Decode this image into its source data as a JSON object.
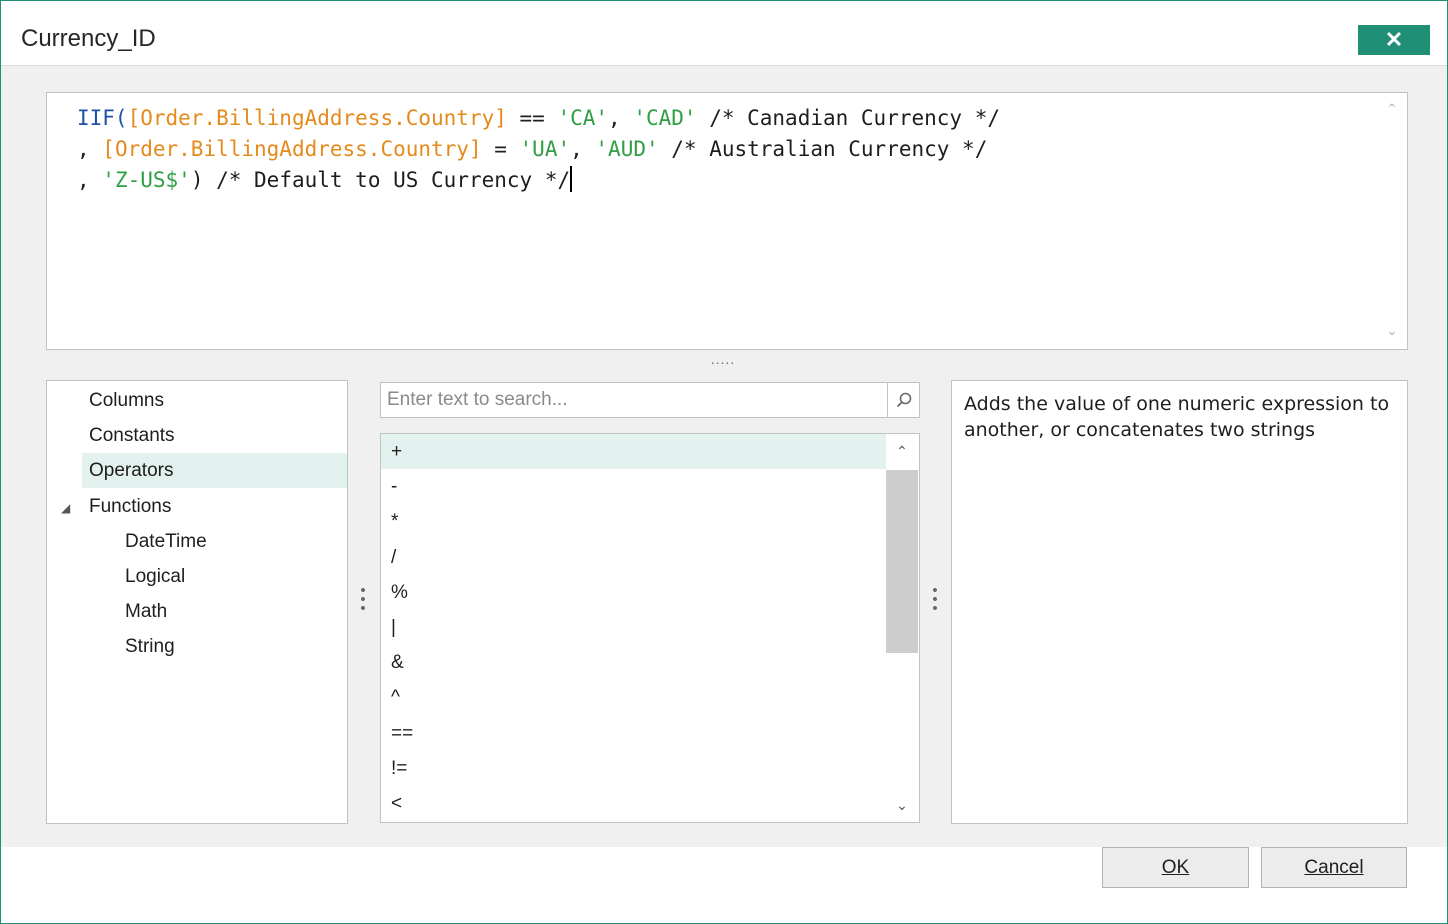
{
  "window": {
    "title": "Currency_ID",
    "close_label": "✕"
  },
  "editor": {
    "lines": [
      [
        {
          "t": "IIF(",
          "c": "kw"
        },
        {
          "t": "[Order.BillingAddress.Country]",
          "c": "fld"
        },
        {
          "t": " == ",
          "c": ""
        },
        {
          "t": "'CA'",
          "c": "str"
        },
        {
          "t": ", ",
          "c": ""
        },
        {
          "t": "'CAD'",
          "c": "str"
        },
        {
          "t": " /* Canadian Currency */",
          "c": ""
        }
      ],
      [
        {
          "t": ", ",
          "c": ""
        },
        {
          "t": "[Order.BillingAddress.Country]",
          "c": "fld"
        },
        {
          "t": " = ",
          "c": ""
        },
        {
          "t": "'UA'",
          "c": "str"
        },
        {
          "t": ", ",
          "c": ""
        },
        {
          "t": "'AUD'",
          "c": "str"
        },
        {
          "t": " /* Australian Currency */",
          "c": ""
        }
      ],
      [
        {
          "t": ", ",
          "c": ""
        },
        {
          "t": "'Z-US$'",
          "c": "str"
        },
        {
          "t": ") /* Default to US Currency */",
          "c": ""
        }
      ]
    ]
  },
  "splitter_label": ".....",
  "categories": [
    {
      "label": "Columns",
      "indent": 0,
      "selected": false
    },
    {
      "label": "Constants",
      "indent": 0,
      "selected": false
    },
    {
      "label": "Operators",
      "indent": 0,
      "selected": true
    },
    {
      "label": "Functions",
      "indent": 0,
      "selected": false,
      "expanded": true
    },
    {
      "label": "DateTime",
      "indent": 1,
      "selected": false
    },
    {
      "label": "Logical",
      "indent": 1,
      "selected": false
    },
    {
      "label": "Math",
      "indent": 1,
      "selected": false
    },
    {
      "label": "String",
      "indent": 1,
      "selected": false
    }
  ],
  "search": {
    "placeholder": "Enter text to search...",
    "value": ""
  },
  "operators": [
    {
      "label": "+",
      "selected": true
    },
    {
      "label": "-",
      "selected": false
    },
    {
      "label": "*",
      "selected": false
    },
    {
      "label": "/",
      "selected": false
    },
    {
      "label": "%",
      "selected": false
    },
    {
      "label": "|",
      "selected": false
    },
    {
      "label": "&",
      "selected": false
    },
    {
      "label": "^",
      "selected": false
    },
    {
      "label": "==",
      "selected": false
    },
    {
      "label": "!=",
      "selected": false
    },
    {
      "label": "<",
      "selected": false
    }
  ],
  "description": "Adds the value of one numeric expression to another, or concatenates two strings",
  "buttons": {
    "ok_label": "OK",
    "cancel_label": "Cancel"
  },
  "colors": {
    "accent": "#1f8f75",
    "selection": "#e3f2ee",
    "keyword": "#1c52a8",
    "field": "#e58a1c",
    "string": "#2f9e44"
  }
}
